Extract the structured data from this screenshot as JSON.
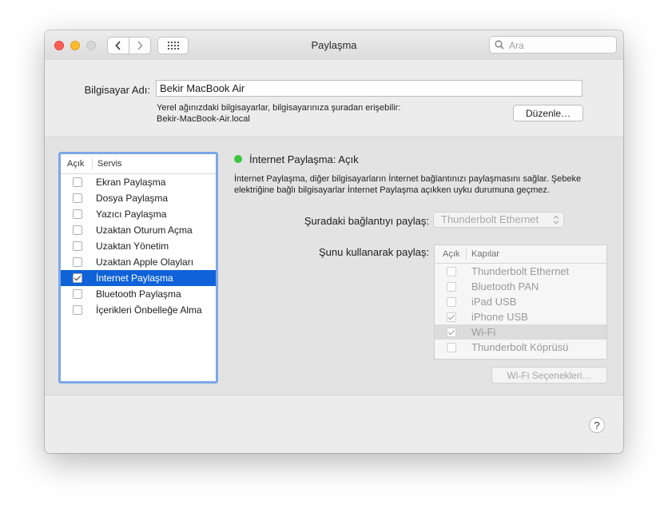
{
  "window": {
    "title": "Paylaşma"
  },
  "search": {
    "placeholder": "Ara",
    "value": ""
  },
  "computer": {
    "label": "Bilgisayar Adı:",
    "value": "Bekir MacBook Air",
    "desc_line1": "Yerel ağınızdaki bilgisayarlar, bilgisayarınıza şuradan erişebilir:",
    "desc_line2": "Bekir-MacBook-Air.local",
    "edit_label": "Düzenle…"
  },
  "services": {
    "header_on": "Açık",
    "header_service": "Servis",
    "items": [
      {
        "label": "Ekran Paylaşma",
        "checked": false,
        "selected": false
      },
      {
        "label": "Dosya Paylaşma",
        "checked": false,
        "selected": false
      },
      {
        "label": "Yazıcı Paylaşma",
        "checked": false,
        "selected": false
      },
      {
        "label": "Uzaktan Oturum Açma",
        "checked": false,
        "selected": false
      },
      {
        "label": "Uzaktan Yönetim",
        "checked": false,
        "selected": false
      },
      {
        "label": "Uzaktan Apple Olayları",
        "checked": false,
        "selected": false
      },
      {
        "label": "İnternet Paylaşma",
        "checked": true,
        "selected": true
      },
      {
        "label": "Bluetooth Paylaşma",
        "checked": false,
        "selected": false
      },
      {
        "label": "İçerikleri Önbelleğe Alma",
        "checked": false,
        "selected": false
      }
    ]
  },
  "detail": {
    "status_title": "İnternet Paylaşma: Açık",
    "status_color": "#3dc43d",
    "info_line1": "İnternet Paylaşma, diğer bilgisayarların İnternet bağlantınızı paylaşmasını sağlar. Şebeke",
    "info_line2": "elektriğine bağlı bilgisayarlar İnternet Paylaşma açıkken uyku durumuna geçmez.",
    "share_from_label": "Şuradaki bağlantıyı paylaş:",
    "share_from_value": "Thunderbolt Ethernet",
    "share_using_label": "Şunu kullanarak paylaş:",
    "ports_header_on": "Açık",
    "ports_header_ports": "Kapılar",
    "ports": [
      {
        "label": "Thunderbolt Ethernet",
        "checked": false,
        "highlighted": false
      },
      {
        "label": "Bluetooth PAN",
        "checked": false,
        "highlighted": false
      },
      {
        "label": "iPad USB",
        "checked": false,
        "highlighted": false
      },
      {
        "label": "iPhone USB",
        "checked": true,
        "highlighted": false
      },
      {
        "label": "Wi-Fi",
        "checked": true,
        "highlighted": true
      },
      {
        "label": "Thunderbolt Köprüsü",
        "checked": false,
        "highlighted": false
      }
    ],
    "wifi_options_label": "Wi-Fi Seçenekleri…"
  },
  "help": {
    "label": "?"
  }
}
